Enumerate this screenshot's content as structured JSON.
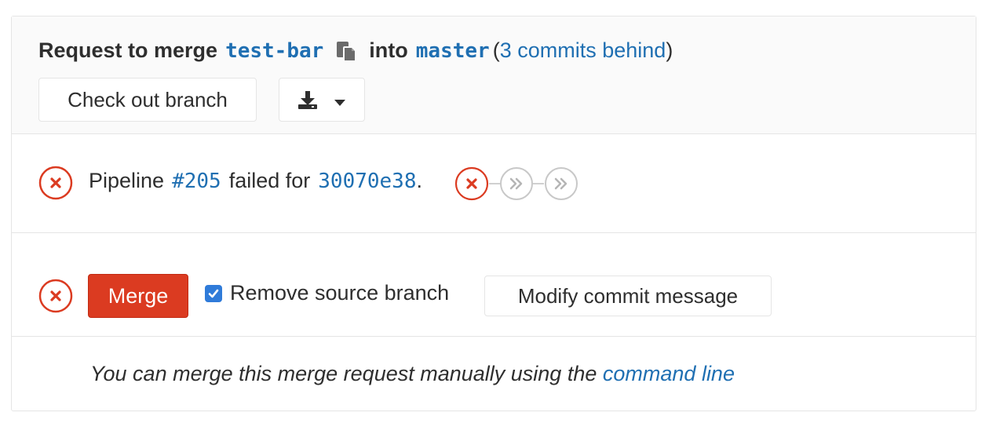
{
  "header": {
    "prefix": "Request to merge",
    "source_branch": "test-bar",
    "middle": "into",
    "target_branch": "master",
    "paren_open": "(",
    "behind": "3 commits behind",
    "paren_close": ")",
    "copy_icon": "clipboard-icon",
    "checkout_label": "Check out branch",
    "download_icon": "download-icon",
    "dropdown_icon": "caret-down-icon"
  },
  "pipeline": {
    "status_icon": "status-failed-icon",
    "label": "Pipeline",
    "id": "#205",
    "failed_for": "failed for",
    "commit": "30070e38",
    "period": ".",
    "stages": [
      {
        "name": "stage-failed",
        "status": "failed"
      },
      {
        "name": "stage-skipped",
        "status": "skipped"
      },
      {
        "name": "stage-skipped",
        "status": "skipped"
      }
    ]
  },
  "merge": {
    "status_icon": "status-failed-icon",
    "merge_label": "Merge",
    "remove_source_label": "Remove source branch",
    "remove_source_checked": true,
    "modify_label": "Modify commit message"
  },
  "note": {
    "text": "You can merge this merge request manually using the",
    "link": "command line"
  },
  "colors": {
    "danger": "#db3b21",
    "link": "#1f6fb2",
    "checkbox": "#2f7bd9",
    "border": "#e5e5e5",
    "header_bg": "#fafafa"
  }
}
